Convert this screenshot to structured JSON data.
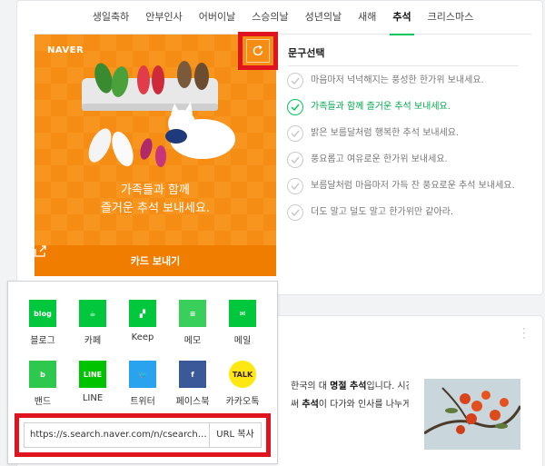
{
  "tabs": [
    "생일축하",
    "안부인사",
    "어버이날",
    "스승의날",
    "성년의날",
    "새해",
    "추석",
    "크리스마스"
  ],
  "active_tab": 6,
  "card": {
    "brand": "NAVER",
    "message_line1": "가족들과 함께",
    "message_line2": "즐거운 추석 보내세요.",
    "send_label": "카드 보내기"
  },
  "phrases": {
    "title": "문구선택",
    "items": [
      "마음마저 넉넉해지는 풍성한 한가위 보내세요.",
      "가족들과 함께 즐거운 추석 보내세요.",
      "밝은 보름달처럼 행복한 추석 보내세요.",
      "풍요롭고 여유로운 한가위 보내세요.",
      "보름달처럼 마음마저 가득 찬 풍요로운 추석 보내세요.",
      "더도 말고 덜도 말고 한가위만 같아라."
    ],
    "selected": 1
  },
  "share": {
    "services": [
      {
        "label": "블로그",
        "icon": "blog-icon",
        "color": "#00c73c"
      },
      {
        "label": "카페",
        "icon": "cafe-icon",
        "color": "#00c73c"
      },
      {
        "label": "Keep",
        "icon": "keep-icon",
        "color": "#00c73c"
      },
      {
        "label": "메모",
        "icon": "memo-icon",
        "color": "#38d05a"
      },
      {
        "label": "메일",
        "icon": "mail-icon",
        "color": "#00c73c"
      },
      {
        "label": "밴드",
        "icon": "band-icon",
        "color": "#2dc84d"
      },
      {
        "label": "LINE",
        "icon": "line-icon",
        "color": "#00c300"
      },
      {
        "label": "트위터",
        "icon": "twitter-icon",
        "color": "#2aa3ef"
      },
      {
        "label": "페이스북",
        "icon": "facebook-icon",
        "color": "#3b5998"
      },
      {
        "label": "카카오톡",
        "icon": "kakaotalk-icon",
        "color": "#ffe812"
      }
    ],
    "url": "https://s.search.naver.com/n/csearch…",
    "copy_label": "URL 복사"
  },
  "article": {
    "line1_pre": "한국의 대 ",
    "line1_bold": "명절 추석",
    "line1_post": "입니다. 시간이",
    "line2_pre": "써 ",
    "line2_bold": "추석",
    "line2_post": "이 다가와 인사를 나누게"
  },
  "icon_names": {
    "refresh": "refresh-icon",
    "share": "share-out-icon",
    "more": "more-vertical-icon",
    "check": "check-icon"
  }
}
